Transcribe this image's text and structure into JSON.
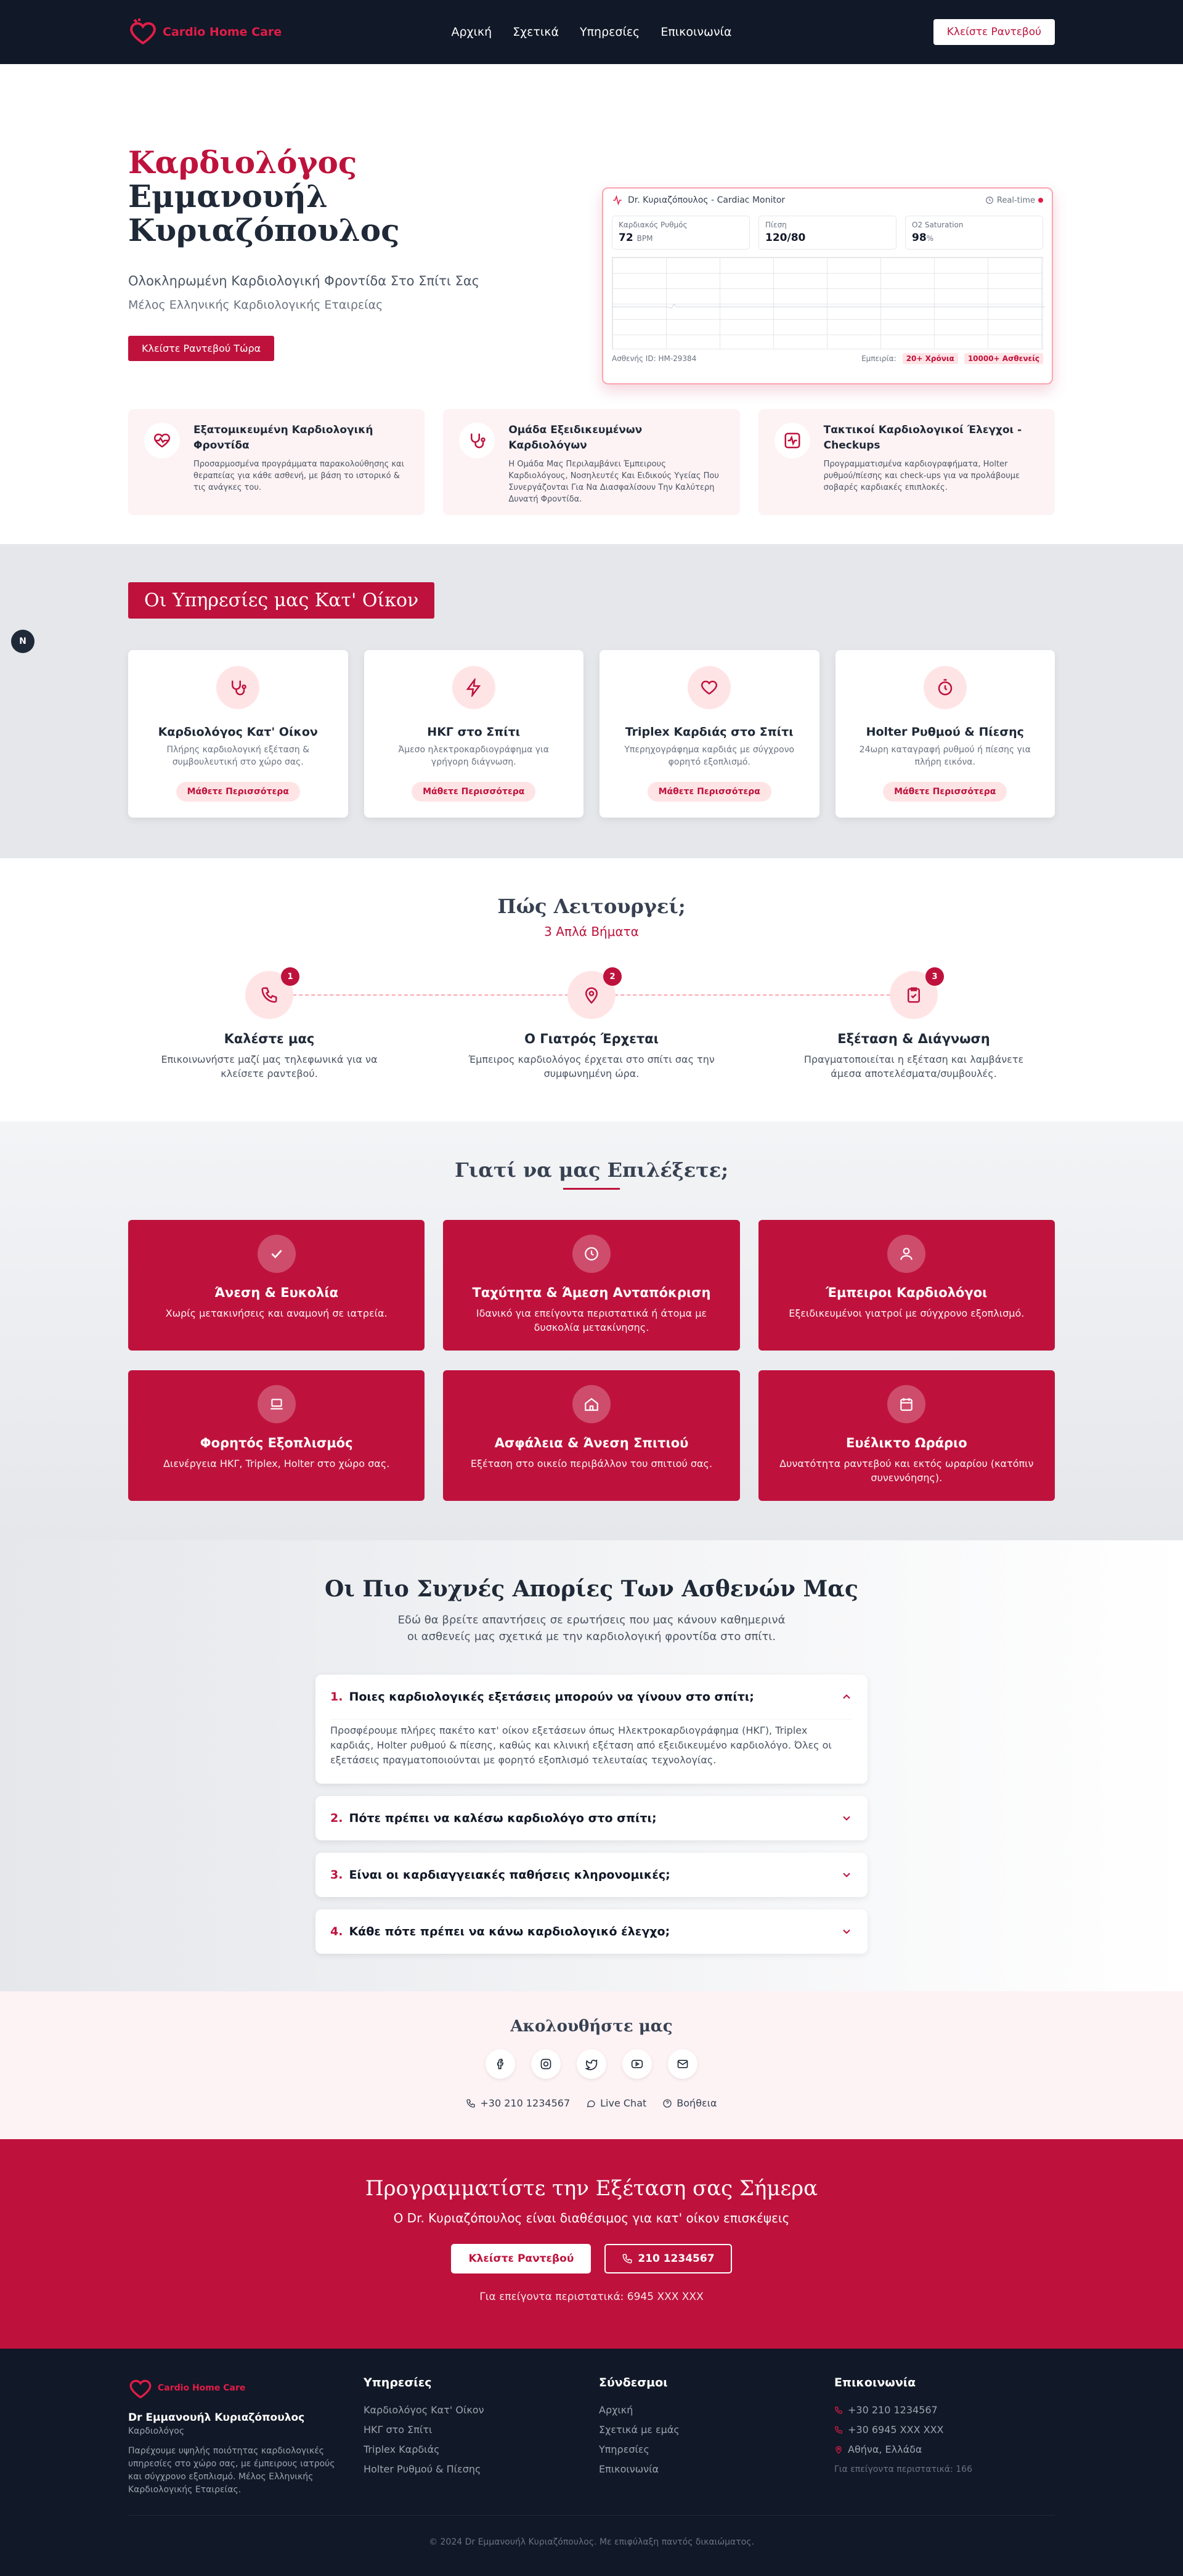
{
  "nav": {
    "logo": "Cardio Home Care",
    "links": [
      "Αρχική",
      "Σχετικά",
      "Υπηρεσίες",
      "Επικοινωνία"
    ],
    "cta": "Κλείστε Ραντεβού"
  },
  "hero": {
    "title_accent": "Καρδιολόγος",
    "title_rest": " Εμμανουήλ Κυριαζόπουλος",
    "subtitle": "Ολοκληρωμένη Καρδιολογική Φροντίδα Στο Σπίτι Σας",
    "member": "Μέλος Ελληνικής Καρδιολογικής Εταιρείας",
    "cta": "Κλείστε Ραντεβού Τώρα"
  },
  "monitor": {
    "title": "Dr. Κυριαζόπουλος - Cardiac Monitor",
    "realtime": "Real-time",
    "stats": [
      {
        "label": "Καρδιακός Ρυθμός",
        "value": "72",
        "unit": "BPM"
      },
      {
        "label": "Πίεση",
        "value": "120/80",
        "unit": ""
      },
      {
        "label": "O2 Saturation",
        "value": "98",
        "unit": "%"
      }
    ],
    "patient_id": "Ασθενής ID: HM-29384",
    "experience_label": "Εμπειρία:",
    "badge_years": "20+ Χρόνια",
    "badge_patients": "10000+ Ασθενείς"
  },
  "features": [
    {
      "icon": "heart-pulse-icon",
      "title": "Εξατομικευμένη Καρδιολογική Φροντίδα",
      "text": "Προσαρμοσμένα προγράμματα παρακολούθησης και θεραπείας για κάθε ασθενή, με βάση το ιστορικό & τις ανάγκες του."
    },
    {
      "icon": "stethoscope-icon",
      "title": "Ομάδα Εξειδικευμένων Καρδιολόγων",
      "text": "Η Ομάδα Μας Περιλαμβάνει Έμπειρους Καρδιολόγους, Νοσηλευτές Και Ειδικούς Υγείας Που Συνεργάζονται Για Να Διασφαλίσουν Την Καλύτερη Δυνατή Φροντίδα."
    },
    {
      "icon": "activity-icon",
      "title": "Τακτικοί Καρδιολογικοί Έλεγχοι - Checkups",
      "text": "Προγραμματισμένα καρδιογραφήματα, Holter ρυθμού/πίεσης και check-ups για να προλάβουμε σοβαρές καρδιακές επιπλοκές."
    }
  ],
  "services": {
    "title": "Οι Υπηρεσίες μας Κατ' Οίκον",
    "more": "Μάθετε Περισσότερα",
    "cards": [
      {
        "icon": "stethoscope-icon",
        "title": "Καρδιολόγος Κατ' Οίκον",
        "text": "Πλήρης καρδιολογική εξέταση & συμβουλευτική στο χώρο σας."
      },
      {
        "icon": "lightning-icon",
        "title": "ΗΚΓ στο Σπίτι",
        "text": "Άμεσο ηλεκτροκαρδιογράφημα για γρήγορη διάγνωση."
      },
      {
        "icon": "heart-icon",
        "title": "Triplex Καρδιάς στο Σπίτι",
        "text": "Υπερηχογράφημα καρδιάς με σύγχρονο φορητό εξοπλισμό."
      },
      {
        "icon": "stopwatch-icon",
        "title": "Holter Ρυθμού & Πίεσης",
        "text": "24ωρη καταγραφή ρυθμού ή πίεσης για πλήρη εικόνα."
      }
    ]
  },
  "side_badge": "N",
  "how": {
    "title": "Πώς Λειτουργεί;",
    "subtitle": "3 Απλά Βήματα",
    "steps": [
      {
        "num": "1",
        "icon": "phone-icon",
        "title": "Καλέστε μας",
        "text": "Επικοινωνήστε μαζί μας τηλεφωνικά για να κλείσετε ραντεβού."
      },
      {
        "num": "2",
        "icon": "map-pin-icon",
        "title": "Ο Γιατρός Έρχεται",
        "text": "Έμπειρος καρδιολόγος έρχεται στο σπίτι σας την συμφωνημένη ώρα."
      },
      {
        "num": "3",
        "icon": "clipboard-check-icon",
        "title": "Εξέταση & Διάγνωση",
        "text": "Πραγματοποιείται η εξέταση και λαμβάνετε άμεσα αποτελέσματα/συμβουλές."
      }
    ]
  },
  "why": {
    "title": "Γιατί να μας Επιλέξετε;",
    "cards": [
      {
        "icon": "check-icon",
        "title": "Άνεση & Ευκολία",
        "text": "Χωρίς μετακινήσεις και αναμονή σε ιατρεία."
      },
      {
        "icon": "clock-icon",
        "title": "Ταχύτητα & Άμεση Ανταπόκριση",
        "text": "Ιδανικό για επείγοντα περιστατικά ή άτομα με δυσκολία μετακίνησης."
      },
      {
        "icon": "user-icon",
        "title": "Έμπειροι Καρδιολόγοι",
        "text": "Εξειδικευμένοι γιατροί με σύγχρονο εξοπλισμό."
      },
      {
        "icon": "laptop-icon",
        "title": "Φορητός Εξοπλισμός",
        "text": "Διενέργεια ΗΚΓ, Triplex, Holter στο χώρο σας."
      },
      {
        "icon": "home-icon",
        "title": "Ασφάλεια & Άνεση Σπιτιού",
        "text": "Εξέταση στο οικείο περιβάλλον του σπιτιού σας."
      },
      {
        "icon": "calendar-icon",
        "title": "Ευέλικτο Ωράριο",
        "text": "Δυνατότητα ραντεβού και εκτός ωραρίου (κατόπιν συνεννόησης)."
      }
    ]
  },
  "faq": {
    "title": "Οι Πιο Συχνές Απορίες Των Ασθενών Μας",
    "subtitle": "Εδώ θα βρείτε απαντήσεις σε ερωτήσεις που μας κάνουν καθημερινά οι ασθενείς μας σχετικά με την καρδιολογική φροντίδα στο σπίτι.",
    "items": [
      {
        "num": "1.",
        "q": "Ποιες καρδιολογικές εξετάσεις μπορούν να γίνουν στο σπίτι;",
        "a": "Προσφέρουμε πλήρες πακέτο κατ' οίκον εξετάσεων όπως Ηλεκτροκαρδιογράφημα (ΗΚΓ), Triplex καρδιάς, Holter ρυθμού & πίεσης, καθώς και κλινική εξέταση από εξειδικευμένο καρδιολόγο. Όλες οι εξετάσεις πραγματοποιούνται με φορητό εξοπλισμό τελευταίας τεχνολογίας.",
        "open": true
      },
      {
        "num": "2.",
        "q": "Πότε πρέπει να καλέσω καρδιολόγο στο σπίτι;",
        "a": "",
        "open": false
      },
      {
        "num": "3.",
        "q": "Είναι οι καρδιαγγειακές παθήσεις κληρονομικές;",
        "a": "",
        "open": false
      },
      {
        "num": "4.",
        "q": "Κάθε πότε πρέπει να κάνω καρδιολογικό έλεγχο;",
        "a": "",
        "open": false
      }
    ]
  },
  "follow": {
    "title": "Ακολουθήστε μας",
    "icons": [
      "facebook-icon",
      "instagram-icon",
      "twitter-icon",
      "youtube-icon",
      "mail-icon"
    ],
    "phone": "+30 210 1234567",
    "chat": "Live Chat",
    "help": "Βοήθεια"
  },
  "cta": {
    "title": "Προγραμματίστε την Εξέταση σας Σήμερα",
    "subtitle": "Ο Dr. Κυριαζόπουλος είναι διαθέσιμος για κατ' οίκον επισκέψεις",
    "btn_book": "Κλείστε Ραντεβού",
    "btn_phone": "210 1234567",
    "emergency": "Για επείγοντα περιστατικά: 6945 XXX XXX"
  },
  "footer": {
    "logo": "Cardio Home Care",
    "name": "Dr Εμμανουήλ Κυριαζόπουλος",
    "role": "Καρδιολόγος",
    "desc": "Παρέχουμε υψηλής ποιότητας καρδιολογικές υπηρεσίες στο χώρο σας, με έμπειρους ιατρούς και σύγχρονο εξοπλισμό. Μέλος Ελληνικής Καρδιολογικής Εταιρείας.",
    "services_title": "Υπηρεσίες",
    "services": [
      "Καρδιολόγος Κατ' Οίκον",
      "ΗΚΓ στο Σπίτι",
      "Triplex Καρδιάς",
      "Holter Ρυθμού & Πίεσης"
    ],
    "links_title": "Σύνδεσμοι",
    "links": [
      "Αρχική",
      "Σχετικά με εμάς",
      "Υπηρεσίες",
      "Επικοινωνία"
    ],
    "contact_title": "Επικοινωνία",
    "contact": [
      "+30 210 1234567",
      "+30 6945 XXX XXX",
      "Αθήνα, Ελλάδα"
    ],
    "emergency": "Για επείγοντα περιστατικά: 166",
    "copyright": "© 2024 Dr Εμμανουήλ Κυριαζόπουλος. Με επιφύλαξη παντός δικαιώματος."
  },
  "colors": {
    "accent": "#be123c",
    "nav_bg": "#111827",
    "soft": "#ffe4e6"
  }
}
